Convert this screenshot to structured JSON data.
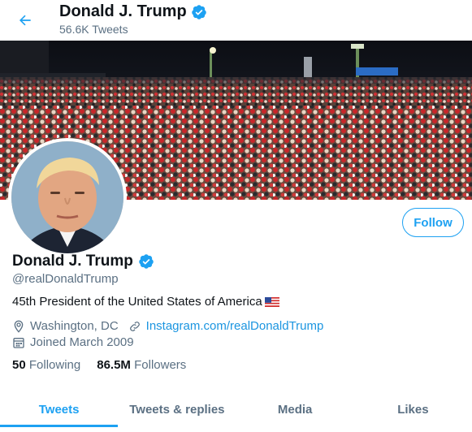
{
  "header": {
    "name": "Donald J. Trump",
    "tweet_count": "56.6K Tweets"
  },
  "banner": {
    "sign_text": "..."
  },
  "profile": {
    "name": "Donald J. Trump",
    "handle": "@realDonaldTrump",
    "bio": "45th President of the United States of America",
    "bio_emoji": "🇺🇸",
    "location": "Washington, DC",
    "website": "Instagram.com/realDonaldTrump",
    "joined": "Joined March 2009",
    "following_count": "50",
    "following_label": "Following",
    "followers_count": "86.5M",
    "followers_label": "Followers",
    "follow_button": "Follow"
  },
  "tabs": [
    {
      "label": "Tweets",
      "active": true
    },
    {
      "label": "Tweets & replies",
      "active": false
    },
    {
      "label": "Media",
      "active": false
    },
    {
      "label": "Likes",
      "active": false
    }
  ],
  "colors": {
    "accent": "#1da1f2",
    "verified": "#1da1f2",
    "secondary_text": "#5b7083"
  },
  "icons": {
    "back": "arrow-left-icon",
    "verified": "verified-badge-icon",
    "location": "location-pin-icon",
    "link": "link-icon",
    "calendar": "calendar-icon"
  }
}
